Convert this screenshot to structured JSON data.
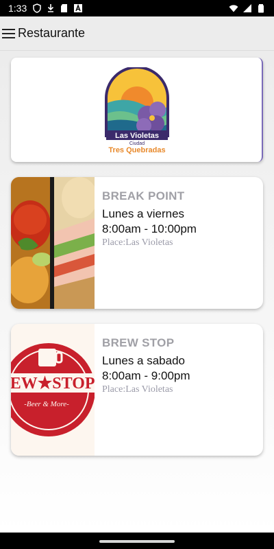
{
  "status": {
    "time": "1:33",
    "left_icons": [
      "shield-icon",
      "download-icon",
      "sd-card-icon",
      "a-box-icon"
    ],
    "right_icons": [
      "wifi-icon",
      "signal-icon",
      "battery-icon"
    ]
  },
  "app_bar": {
    "title": "Restaurante",
    "menu_icon": "hamburger-menu-icon"
  },
  "logo": {
    "line1": "Las Violetas",
    "line2": "Ciudad",
    "line3": "Tres Quebradas"
  },
  "restaurants": [
    {
      "name": "BREAK POINT",
      "days": "Lunes a viernes",
      "hours": "8:00am - 10:00pm",
      "place": "Place:Las Violetas"
    },
    {
      "name": "BREW STOP",
      "days": "Lunes a sabado",
      "hours": "8:00am - 9:00pm",
      "place": "Place:Las Violetas",
      "logo_text": "REW★STOP",
      "logo_sub": "-Beer & More-"
    }
  ]
}
